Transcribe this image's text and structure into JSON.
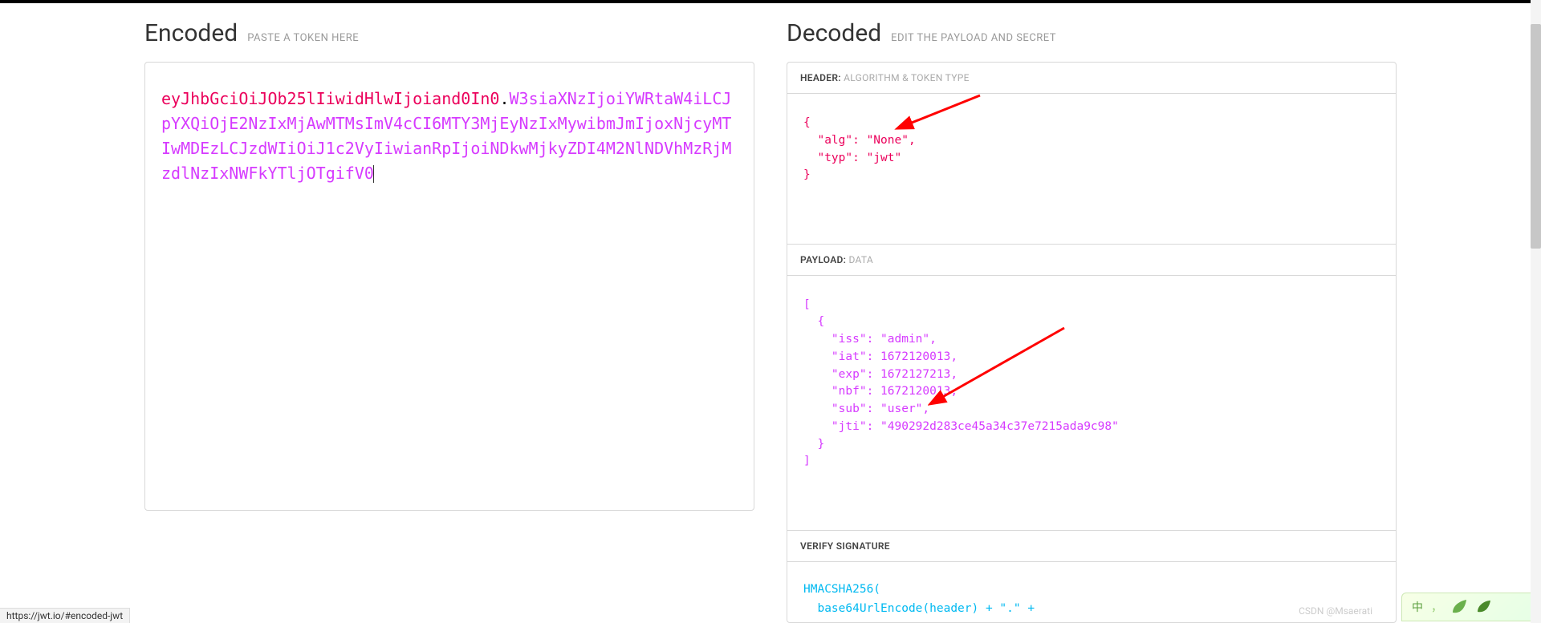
{
  "encoded": {
    "title": "Encoded",
    "subtitle": "PASTE A TOKEN HERE",
    "token_header": "eyJhbGciOiJOb25lIiwidHlwIjoiand0In0",
    "token_payload": "W3siaXNzIjoiYWRtaW4iLCJpYXQiOjE2NzIxMjAwMTMsImV4cCI6MTY3MjEyNzIxMywibmJmIjoxNjcyMTIwMDEzLCJzdWIiOiJ1c2VyIiwianRpIjoiNDkwMjkyZDI4M2NlNDVhMzRjMzdlNzIxNWFkYTljOTgifV0",
    "dot": "."
  },
  "decoded": {
    "title": "Decoded",
    "subtitle": "EDIT THE PAYLOAD AND SECRET",
    "header_section": {
      "label": "HEADER:",
      "sublabel": "ALGORITHM & TOKEN TYPE",
      "body": "{\n  \"alg\": \"None\",\n  \"typ\": \"jwt\"\n}"
    },
    "payload_section": {
      "label": "PAYLOAD:",
      "sublabel": "DATA",
      "body": "[\n  {\n    \"iss\": \"admin\",\n    \"iat\": 1672120013,\n    \"exp\": 1672127213,\n    \"nbf\": 1672120013,\n    \"sub\": \"user\",\n    \"jti\": \"490292d283ce45a34c37e7215ada9c98\"\n  }\n]"
    },
    "signature_section": {
      "label": "VERIFY SIGNATURE",
      "line1": "HMACSHA256(",
      "line2": "  base64UrlEncode(header) + \".\" +"
    }
  },
  "status_url": "https://jwt.io/#encoded-jwt",
  "watermark": "CSDN @Msaerati",
  "ime": {
    "char": "中",
    "comma": "，"
  }
}
